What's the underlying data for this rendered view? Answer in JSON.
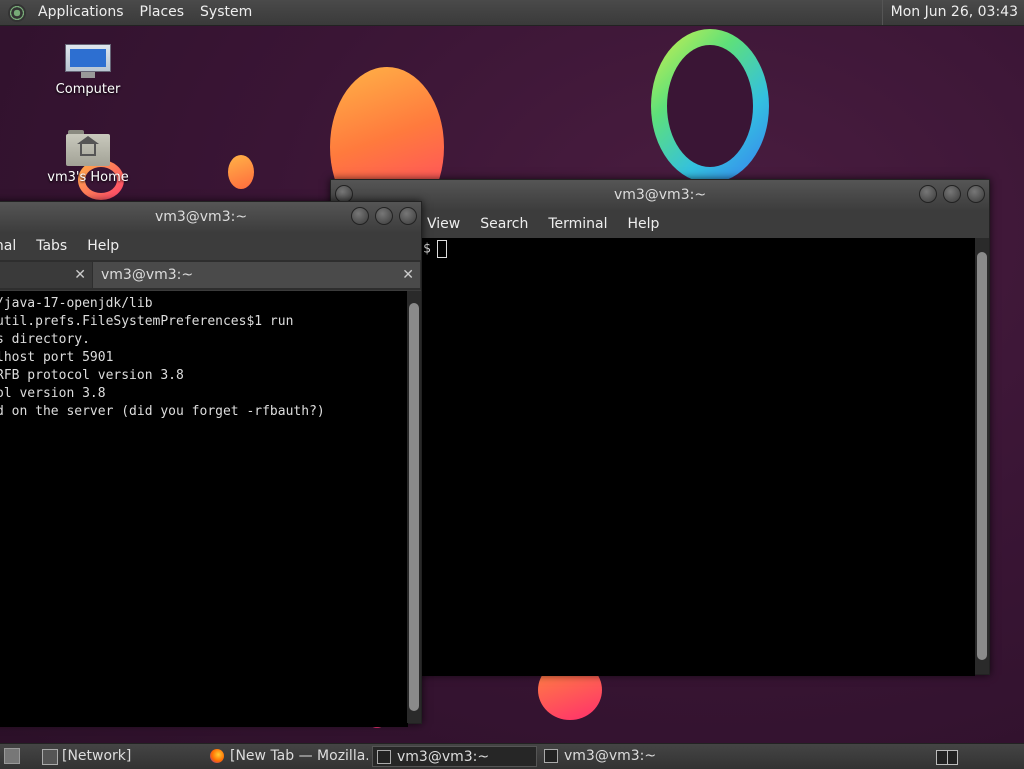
{
  "top_panel": {
    "menus": [
      "Applications",
      "Places",
      "System"
    ],
    "clock": "Mon Jun 26, 03:43"
  },
  "desktop_icons": [
    {
      "label": "Computer",
      "icon": "computer-icon"
    },
    {
      "label": "vm3's Home",
      "icon": "home-folder-icon"
    }
  ],
  "left_window": {
    "title": "vm3@vm3:~",
    "menus": [
      "inal",
      "Tabs",
      "Help"
    ],
    "tabs": [
      {
        "label": ""
      },
      {
        "label": "vm3@vm3:~"
      }
    ],
    "lines": [
      "/java-17-openjdk/lib",
      "util.prefs.FileSystemPreferences$1 run",
      "s directory.",
      "lhost port 5901",
      "RFB protocol version 3.8",
      "ol version 3.8",
      "d on the server (did you forget -rfbauth?)"
    ]
  },
  "right_window": {
    "title": "vm3@vm3:~",
    "menus": [
      "View",
      "Search",
      "Terminal",
      "Help"
    ],
    "prompt": "$"
  },
  "taskbar": {
    "tasks": [
      {
        "label": "[Network]",
        "icon": "network-folder-icon"
      },
      {
        "label": "[New Tab — Mozilla...",
        "icon": "firefox-icon"
      },
      {
        "label": "vm3@vm3:~",
        "icon": "terminal-icon"
      },
      {
        "label": "vm3@vm3:~",
        "icon": "terminal-icon"
      }
    ]
  }
}
